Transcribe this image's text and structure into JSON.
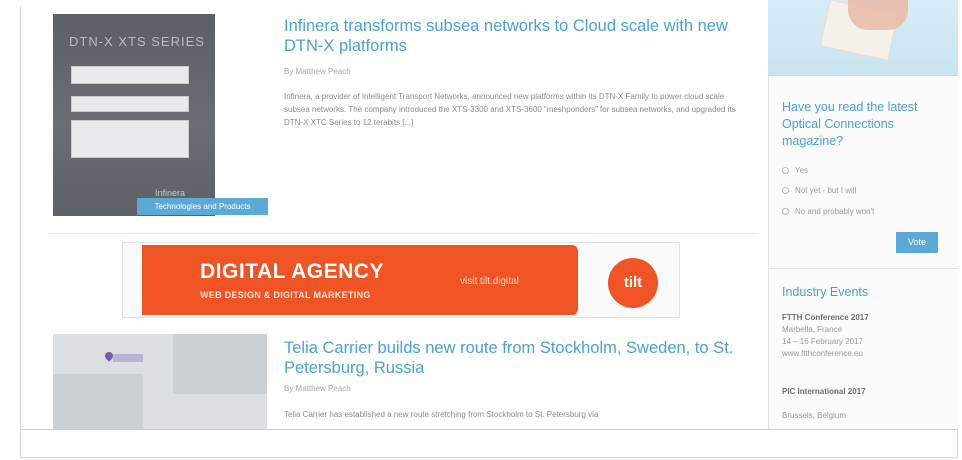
{
  "articles": [
    {
      "title": "Infinera transforms subsea networks to Cloud scale with new DTN-X platforms",
      "byline": "By Matthew Peach",
      "excerpt": "Infinera, a provider of Intelligent Transport Networks, announced new platforms within its DTN-X Family to power cloud scale subsea networks. The company introduced the XTS-3300 and XTS-3600 “meshponders” for subsea networks, and upgraded its DTN-X XTC Series to 12 terabits [...]",
      "category": "Technologies and Products",
      "thumb_series": "DTN-X XTS SERIES",
      "thumb_brand": "Infinera"
    },
    {
      "title": "Telia Carrier builds new route from Stockholm, Sweden, to St. Petersburg, Russia",
      "byline": "By Matthew Peach",
      "excerpt": "Telia Carrier has established a new route stretching from Stockholm to St. Petersburg via"
    }
  ],
  "ad": {
    "title": "DIGITAL AGENCY",
    "subtitle": "WEB DESIGN & DIGITAL MARKETING",
    "visit": "visit tilt.digital",
    "logo": "tilt"
  },
  "poll": {
    "question": "Have you read the latest Optical Connections magazine?",
    "options": [
      "Yes",
      "Not yet - but I will",
      "No and probably won't"
    ],
    "vote_label": "Vote"
  },
  "events": {
    "title": "Industry Events",
    "items": [
      {
        "name": "FTTH Conference 2017",
        "place": "Marbella, France",
        "date": "14 – 16 February 2017",
        "url": "www.ftthconference.eu"
      },
      {
        "name": "PIC International 2017",
        "place": "Brussels, Belgium"
      }
    ]
  },
  "colors": {
    "link_blue": "#49a1d8",
    "badge_blue": "#5aa9d6",
    "ad_orange": "#f05324"
  }
}
